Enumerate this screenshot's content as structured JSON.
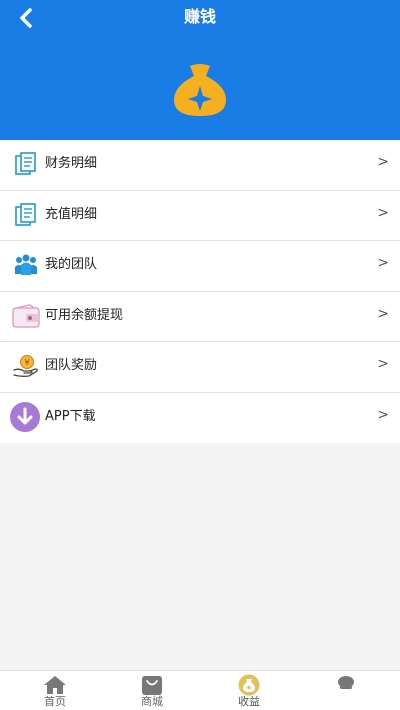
{
  "header": {
    "title": "赚钱"
  },
  "menu": [
    {
      "label": "财务明细",
      "icon": "finance-doc-icon"
    },
    {
      "label": "充值明细",
      "icon": "recharge-doc-icon"
    },
    {
      "label": "我的团队",
      "icon": "team-people-icon"
    },
    {
      "label": "可用余额提现",
      "icon": "wallet-icon"
    },
    {
      "label": "团队奖励",
      "icon": "coin-hand-icon"
    },
    {
      "label": "APP下载",
      "icon": "download-icon"
    }
  ],
  "chevron": ">",
  "tabbar": [
    {
      "label": "首页",
      "icon": "home-icon"
    },
    {
      "label": "商城",
      "icon": "shopping-bag-icon"
    },
    {
      "label": "收益",
      "icon": "money-bag-icon",
      "active": true
    },
    {
      "label": "",
      "icon": "profile-icon"
    }
  ],
  "colors": {
    "primary": "#1a7de6",
    "accent": "#f5b021",
    "purple": "#a77ad6"
  }
}
